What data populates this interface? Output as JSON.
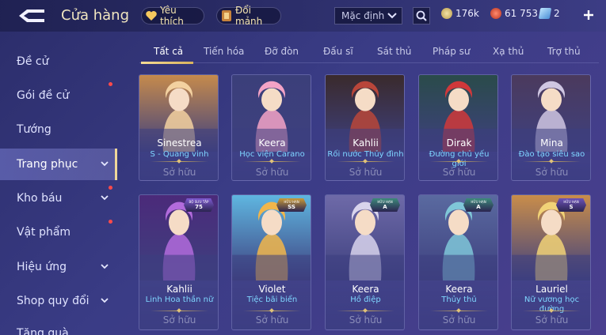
{
  "header": {
    "title": "Cửa hàng",
    "favorites_label": "Yêu thích",
    "exchange_label": "Đổi mảnh",
    "sort": {
      "selected": "Mặc định"
    },
    "currencies": [
      {
        "name": "gold-coin",
        "value": "176k",
        "color": "#d9c07a"
      },
      {
        "name": "ruby",
        "value": "61 753",
        "color": "#e8533d"
      },
      {
        "name": "voucher",
        "value": "2",
        "color": "#8fd0ff"
      }
    ]
  },
  "sidebar": {
    "items": [
      {
        "label": "Đề cử",
        "has_dot": false,
        "has_chevron": false
      },
      {
        "label": "Gói đề cử",
        "has_dot": true,
        "has_chevron": false
      },
      {
        "label": "Tướng",
        "has_dot": false,
        "has_chevron": false
      },
      {
        "label": "Trang phục",
        "has_dot": false,
        "has_chevron": true,
        "active": true
      },
      {
        "label": "Kho báu",
        "has_dot": true,
        "has_chevron": true
      },
      {
        "label": "Vật phẩm",
        "has_dot": true,
        "has_chevron": false
      },
      {
        "label": "Hiệu ứng",
        "has_dot": false,
        "has_chevron": true
      },
      {
        "label": "Shop quy đổi",
        "has_dot": false,
        "has_chevron": true
      },
      {
        "label": "Tặng quà",
        "has_dot": false,
        "has_chevron": false
      }
    ]
  },
  "tabs": [
    "Tất cả",
    "Tiến hóa",
    "Đỡ đòn",
    "Đấu sĩ",
    "Sát thủ",
    "Pháp sư",
    "Xạ thủ",
    "Trợ thủ"
  ],
  "cards": [
    {
      "hero": "Sinestrea",
      "skin": "S - Quang vinh",
      "status": "Sở hữu",
      "palette": [
        "#f3d1a0",
        "#c58a4c"
      ]
    },
    {
      "hero": "Keera",
      "skin": "Học viện Carano",
      "status": "Sở hữu",
      "palette": [
        "#f3a3c6",
        "#3b3f7a"
      ]
    },
    {
      "hero": "Kahlii",
      "skin": "Rối nước Thủy đình",
      "status": "Sở hữu",
      "palette": [
        "#b8463a",
        "#3a2a2c"
      ]
    },
    {
      "hero": "Dirak",
      "skin": "Đường chủ yếu giới",
      "status": "Sở hữu",
      "palette": [
        "#d0383a",
        "#2a4b4a"
      ]
    },
    {
      "hero": "Mina",
      "skin": "Đào tạo siêu sao",
      "status": "Sở hữu",
      "palette": [
        "#cfc6e2",
        "#4b3a5d"
      ]
    },
    {
      "hero": "Kahlii",
      "skin": "Linh Hoa thần nữ",
      "status": "Sở hữu",
      "palette": [
        "#b26bdc",
        "#4b2a7a"
      ],
      "badge": {
        "text": "75",
        "sub": "BỘ SƯU TẬP",
        "color": "#7d5ad0"
      }
    },
    {
      "hero": "Violet",
      "skin": "Tiệc bãi biển",
      "status": "Sở hữu",
      "palette": [
        "#f2b64a",
        "#5fb6e0"
      ],
      "badge": {
        "text": "SS",
        "sub": "HỮU HẠN",
        "color": "#c89a3a"
      }
    },
    {
      "hero": "Keera",
      "skin": "Hồ điệp",
      "status": "Sở hữu",
      "palette": [
        "#d8d4ec",
        "#6e6aa8"
      ],
      "badge": {
        "text": "A",
        "sub": "HỮU HẠN",
        "color": "#3d8a7a"
      }
    },
    {
      "hero": "Keera",
      "skin": "Thủy thủ",
      "status": "Sở hữu",
      "palette": [
        "#7fc7d8",
        "#5a6aa0"
      ],
      "badge": {
        "text": "A",
        "sub": "HỮU HẠN",
        "color": "#3d8a7a"
      }
    },
    {
      "hero": "Lauriel",
      "skin": "Nữ vương học đường",
      "status": "Sở hữu",
      "palette": [
        "#f1d277",
        "#c98d4a"
      ],
      "badge": {
        "text": "S",
        "sub": "HỮU HẠN",
        "color": "#6c52b8"
      }
    }
  ]
}
